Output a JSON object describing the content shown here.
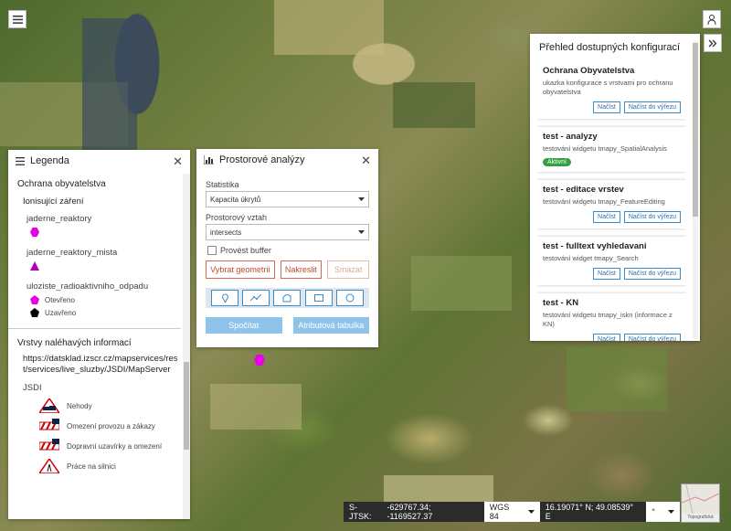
{
  "legend": {
    "title": "Legenda",
    "group1": "Ochrana obyvatelstva",
    "subgroup1": "Ionisující záření",
    "layers": [
      {
        "name": "jaderne_reaktory"
      },
      {
        "name": "jaderne_reaktory_mista"
      },
      {
        "name": "uloziste_radioaktivniho_odpadu"
      }
    ],
    "status_open": "Otevřeno",
    "status_closed": "Uzavřeno",
    "group2": "Vrstvy naléhavých informací",
    "service_url": "https://datsklad.izscr.cz/mapservices/rest/services/live_sluzby/JSDI/MapServer",
    "jsdi_label": "JSDI",
    "traffic": [
      "Nehody",
      "Omezení provozu a zákazy",
      "Dopravní uzavírky a omezení",
      "Práce na silnici"
    ]
  },
  "analysis": {
    "title": "Prostorové analýzy",
    "stat_label": "Statistika",
    "stat_value": "Kapacita úkrytů",
    "relation_label": "Prostorový vztah",
    "relation_value": "intersects",
    "buffer_label": "Provést buffer",
    "select_geom": "Vybrat geometrii",
    "draw": "Nakreslit",
    "delete": "Smazat",
    "compute": "Spočítat",
    "attr_table": "Atributová tabulka"
  },
  "configs": {
    "title": "Přehled dostupných konfigurací",
    "load_label": "Načíst",
    "load_extent_label": "Načíst do výřezu",
    "items": [
      {
        "name": "Ochrana Obyvatelstva",
        "desc": "ukazka konfigurace s vrstvami pro ochranu obyvatelstva"
      },
      {
        "name": "test - analyzy",
        "desc": "testování widgetu tmapy_SpatialAnalysis",
        "badge": "Aktivní"
      },
      {
        "name": "test - editace vrstev",
        "desc": "testování widgetu tmapy_FeatureEditing"
      },
      {
        "name": "test - fulltext vyhledavani",
        "desc": "testování widget tmapy_Search"
      },
      {
        "name": "test - KN",
        "desc": "testování widgetu tmapy_iskn (informace z KN)"
      }
    ]
  },
  "coords": {
    "system": "S-JTSK:",
    "xy": "-629767.34; -1169527.37",
    "wgs": "WGS 84",
    "latlon": "16.19071° N; 49.08539° E",
    "unit": "°"
  },
  "basemap_label": "Topografická",
  "colors": {
    "marker": "#e600e6",
    "accent": "#3c8ac8",
    "active": "#34a043"
  }
}
